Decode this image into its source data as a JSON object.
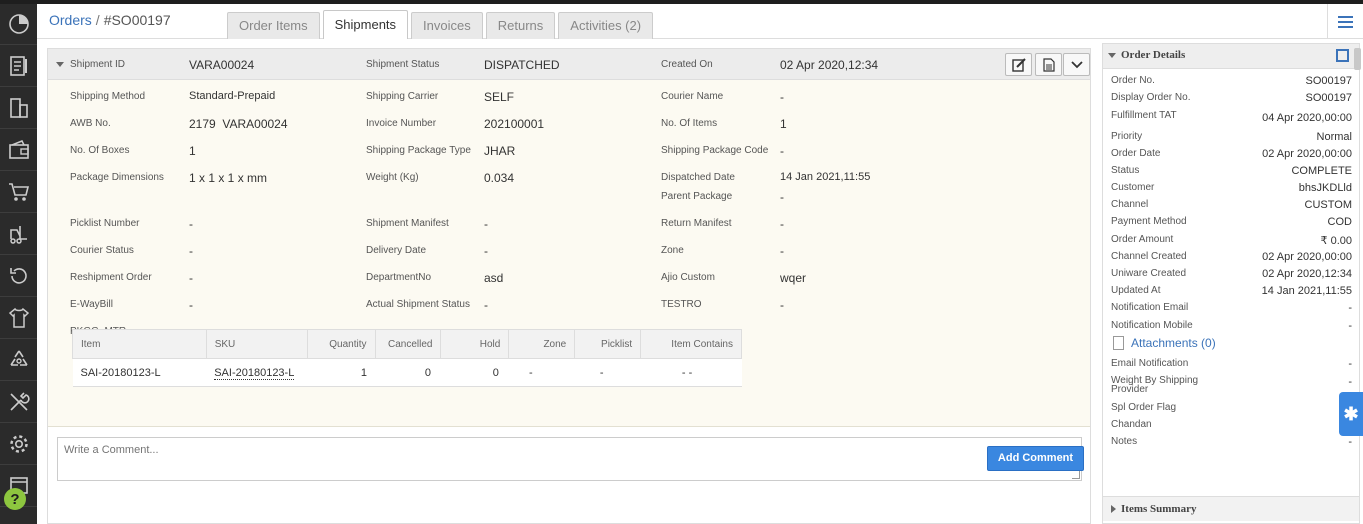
{
  "breadcrumb": {
    "root": "Orders",
    "separator": "/",
    "current": "#SO00197"
  },
  "tabs": [
    {
      "label": "Order Items",
      "active": false
    },
    {
      "label": "Shipments",
      "active": true
    },
    {
      "label": "Invoices",
      "active": false
    },
    {
      "label": "Returns",
      "active": false
    },
    {
      "label": "Activities (2)",
      "active": false
    }
  ],
  "shipment": {
    "header": {
      "id_label": "Shipment ID",
      "id_value": "VARA00024",
      "status_label": "Shipment Status",
      "status_value": "DISPATCHED",
      "created_label": "Created On",
      "created_value": "02 Apr 2020,12:34"
    },
    "fields": {
      "shipping_method": {
        "label": "Shipping Method",
        "value": "Standard-Prepaid"
      },
      "shipping_carrier": {
        "label": "Shipping Carrier",
        "value": "SELF"
      },
      "courier_name": {
        "label": "Courier Name",
        "value": "-"
      },
      "awb_no": {
        "label": "AWB No.",
        "value": "2179  VARA00024"
      },
      "invoice_number": {
        "label": "Invoice Number",
        "value": "202100001"
      },
      "no_of_items": {
        "label": "No. Of Items",
        "value": "1"
      },
      "no_of_boxes": {
        "label": "No. Of Boxes",
        "value": "1"
      },
      "shipping_package_type": {
        "label": "Shipping Package Type",
        "value": "JHAR"
      },
      "shipping_package_code": {
        "label": "Shipping Package Code",
        "value": "-"
      },
      "package_dimensions": {
        "label": "Package Dimensions",
        "value": "1 x 1 x 1 x mm"
      },
      "weight": {
        "label": "Weight (Kg)",
        "value": "0.034"
      },
      "dispatched_date": {
        "label": "Dispatched Date",
        "value": "14 Jan 2021,11:55"
      },
      "parent_package": {
        "label": "Parent Package",
        "value": "-"
      },
      "picklist_number": {
        "label": "Picklist Number",
        "value": "-"
      },
      "shipment_manifest": {
        "label": "Shipment Manifest",
        "value": "-"
      },
      "return_manifest": {
        "label": "Return Manifest",
        "value": "-"
      },
      "courier_status": {
        "label": "Courier Status",
        "value": "-"
      },
      "delivery_date": {
        "label": "Delivery Date",
        "value": "-"
      },
      "zone": {
        "label": "Zone",
        "value": "-"
      },
      "reshipment_order": {
        "label": "Reshipment Order",
        "value": "-"
      },
      "department_no": {
        "label": "DepartmentNo",
        "value": "asd"
      },
      "ajio_custom": {
        "label": "Ajio Custom",
        "value": "wqer"
      },
      "eway_bill": {
        "label": "E-WayBill",
        "value": "-"
      },
      "actual_shipment_status": {
        "label": "Actual Shipment Status",
        "value": "-"
      },
      "testro": {
        "label": "TESTRO",
        "value": "-"
      },
      "pkgg_mtr": {
        "label": "PKGG_MTR",
        "value": "-"
      }
    },
    "items_table": {
      "headers": [
        "Item",
        "SKU",
        "Quantity",
        "Cancelled",
        "Hold",
        "Zone",
        "Picklist",
        "Item Contains"
      ],
      "rows": [
        [
          "SAI-20180123-L",
          "SAI-20180123-L",
          "1",
          "0",
          "0",
          "-",
          "-",
          "- -"
        ]
      ]
    }
  },
  "comment": {
    "placeholder": "Write a Comment...",
    "button": "Add Comment"
  },
  "order_details": {
    "title": "Order Details",
    "rows": [
      {
        "k": "Order No.",
        "v": "SO00197"
      },
      {
        "k": "Display Order No.",
        "v": "SO00197"
      },
      {
        "k": "Fulfillment TAT",
        "v": "04 Apr 2020,00:00"
      },
      {
        "k": "Priority",
        "v": "Normal"
      },
      {
        "k": "Order Date",
        "v": "02 Apr 2020,00:00"
      },
      {
        "k": "Status",
        "v": "COMPLETE"
      },
      {
        "k": "Customer",
        "v": "bhsJKDLld"
      },
      {
        "k": "Channel",
        "v": "CUSTOM"
      },
      {
        "k": "Payment Method",
        "v": "COD"
      },
      {
        "k": "Order Amount",
        "v": "₹ 0.00"
      },
      {
        "k": "Channel Created",
        "v": "02 Apr 2020,00:00"
      },
      {
        "k": "Uniware Created",
        "v": "02 Apr 2020,12:34"
      },
      {
        "k": "Updated At",
        "v": "14 Jan 2021,11:55"
      },
      {
        "k": "Notification Email",
        "v": "-"
      },
      {
        "k": "Notification Mobile",
        "v": "-"
      }
    ],
    "attachments": "Attachments (0)",
    "rows2": [
      {
        "k": "Email Notification",
        "v": "-"
      },
      {
        "k": "Weight By Shipping Provider",
        "v": "-"
      },
      {
        "k": "Spl Order Flag",
        "v": ""
      },
      {
        "k": "Chandan",
        "v": ""
      },
      {
        "k": "Notes",
        "v": "-"
      }
    ]
  },
  "items_summary": {
    "title": "Items Summary"
  },
  "colors": {
    "accent": "#3b73b9",
    "button_blue": "#3a87e0",
    "sidebar": "#2b2b2b",
    "help": "#8dc63f"
  }
}
